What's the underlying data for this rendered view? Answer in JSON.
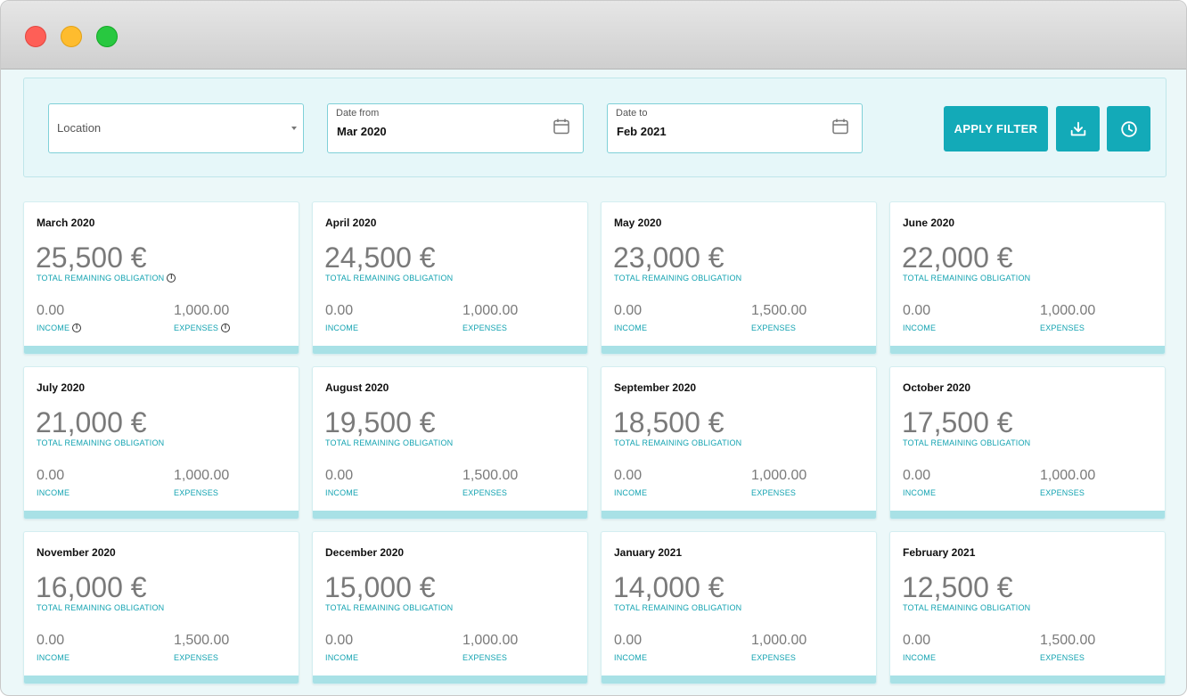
{
  "filters": {
    "location_placeholder": "Location",
    "date_from_label": "Date from",
    "date_from_value": "Mar 2020",
    "date_to_label": "Date to",
    "date_to_value": "Feb 2021",
    "apply_label": "APPLY FILTER"
  },
  "icons": {
    "calendar": "calendar-icon",
    "download": "download-icon",
    "history": "clock-icon",
    "info": "info-icon"
  },
  "colors": {
    "accent": "#13aab8",
    "caption": "#13a3b1",
    "card_footer": "#a8e1e6"
  },
  "labels": {
    "total": "TOTAL REMAINING OBLIGATION",
    "income": "INCOME",
    "expenses": "EXPENSES",
    "info_glyph": "i"
  },
  "cards": [
    {
      "month": "March 2020",
      "total": "25,500 €",
      "income": "0.00",
      "expenses": "1,000.00",
      "info": true
    },
    {
      "month": "April 2020",
      "total": "24,500 €",
      "income": "0.00",
      "expenses": "1,000.00",
      "info": false
    },
    {
      "month": "May 2020",
      "total": "23,000 €",
      "income": "0.00",
      "expenses": "1,500.00",
      "info": false
    },
    {
      "month": "June 2020",
      "total": "22,000 €",
      "income": "0.00",
      "expenses": "1,000.00",
      "info": false
    },
    {
      "month": "July 2020",
      "total": "21,000 €",
      "income": "0.00",
      "expenses": "1,000.00",
      "info": false
    },
    {
      "month": "August 2020",
      "total": "19,500 €",
      "income": "0.00",
      "expenses": "1,500.00",
      "info": false
    },
    {
      "month": "September 2020",
      "total": "18,500 €",
      "income": "0.00",
      "expenses": "1,000.00",
      "info": false
    },
    {
      "month": "October 2020",
      "total": "17,500 €",
      "income": "0.00",
      "expenses": "1,000.00",
      "info": false
    },
    {
      "month": "November 2020",
      "total": "16,000 €",
      "income": "0.00",
      "expenses": "1,500.00",
      "info": false
    },
    {
      "month": "December 2020",
      "total": "15,000 €",
      "income": "0.00",
      "expenses": "1,000.00",
      "info": false
    },
    {
      "month": "January 2021",
      "total": "14,000 €",
      "income": "0.00",
      "expenses": "1,000.00",
      "info": false
    },
    {
      "month": "February 2021",
      "total": "12,500 €",
      "income": "0.00",
      "expenses": "1,500.00",
      "info": false
    }
  ]
}
